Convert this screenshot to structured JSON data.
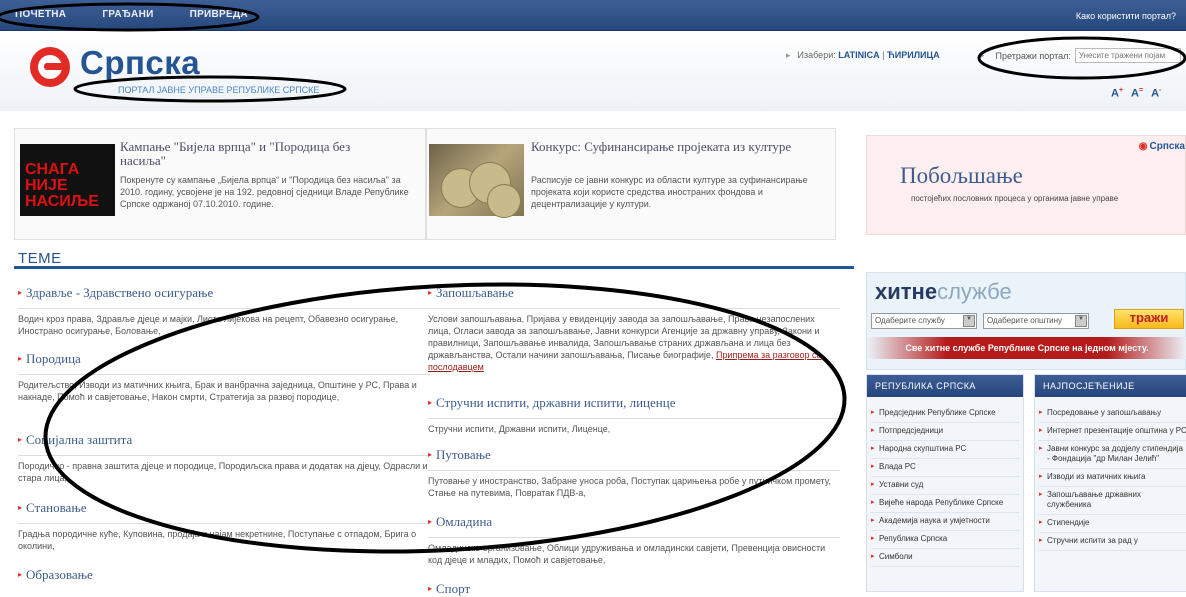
{
  "top_nav": [
    "ПОЧЕТНА",
    "ГРАЂАНИ",
    "ПРИВРЕДА"
  ],
  "help_link": "Како користити портал?",
  "logo": {
    "text": "Српска",
    "subtitle": "ПОРТАЛ ЈАВНЕ УПРАВЕ РЕПУБЛИКЕ СРПСКЕ"
  },
  "language": {
    "label": "Изабери:",
    "latin": "LATINICA",
    "cyrillic": "ЋИРИЛИЦА"
  },
  "search": {
    "label": "Претражи портал:",
    "placeholder": "Унесите тражени појам"
  },
  "font_controls": [
    "A",
    "A",
    "A"
  ],
  "font_marks": [
    "+",
    "=",
    "-"
  ],
  "news": [
    {
      "title": "Кампање \"Бијела врпца\" и \"Породица без насиља\"",
      "text": "Покренуте су кампање „Бијела врпца“ и \"Породица без насиља\" за 2010. годину, усвојене је на 192. редовној сједници Владе Републике Српске одржаној 07.10.2010. године.",
      "image_text": [
        "СНАГА НИЈЕ",
        "НАСИЉЕ"
      ]
    },
    {
      "title": "Конкурс: Суфинансирање пројеката из културе",
      "text": "Расписује се јавни конкурс из области културе за суфинансирање пројеката који користе средства иностраних фондова и децентрализације у култури."
    }
  ],
  "promo": {
    "logo": "Српска",
    "title": "Побољшање",
    "subtitle": "постојећих пословних процеса у органима јавне управе"
  },
  "section_title": "ТЕМЕ",
  "topics_left": [
    {
      "title": "Здравље - Здравствено осигурање",
      "text": "Водич кроз права, Здравље дјеце и мајки, Листа лијекова на рецепт, Обавезно осигурање, Инострано осигурање, Боловање,"
    },
    {
      "title": "Породица",
      "text": "Родитељство, Изводи из матичних књига, Брак и ванбрачна заједница, Општине у РС, Права и накнаде, Помоћ и савјетовање, Након смрти, Стратегија за развој породице,"
    },
    {
      "title": "Социјална заштита",
      "text": "Породично - правна заштита дјеце и породице, Породиљска права и додатак на дјецу, Одрасли и стара лица,"
    },
    {
      "title": "Становање",
      "text": "Градња породичне куће, Куповина, продаја и најам некретнине, Поступање с отпадом, Брига о околини,"
    },
    {
      "title": "Образовање",
      "text": ""
    }
  ],
  "topics_right": [
    {
      "title": "Запошљавање",
      "text": "Услови запошљавања, Пријава у евиденцију завода за запошљавање, Права незапослених лица, Огласи завода за запошљавање, Јавни конкурси Агенције за државну управу, Закони и правилници, Запошљавање инвалида, Запошљавање страних држављана и лица без држављанства, Остали начини запошљавања, Писање биографије, ",
      "link": "Припрема за разговор са послодавцем"
    },
    {
      "title": "Стручни испити, државни испити, лиценце",
      "text": "Стручни испити, Државни испити, Лиценце,"
    },
    {
      "title": "Путовање",
      "text": "Путовање у иностранство, Забране уноса роба, Поступак царињења робе у путничком промету, Стање на путевима, Повратак ПДВ-а,"
    },
    {
      "title": "Омладина",
      "text": "Омладинско организовање, Облици удруживања и омладински савјети, Превенција овисности код дјеце и младих, Помоћ и савјетовање,"
    },
    {
      "title": "Спорт",
      "text": ""
    }
  ],
  "hitne": {
    "title_bold": "хитне",
    "title_light": "службе",
    "select1": "Одаберите службу",
    "select2": "Одаберите општину",
    "button": "тражи",
    "note": "Све хитне службе Републике Српске на једном мјесту."
  },
  "col1": {
    "title": "РЕПУБЛИКА СРПСКА",
    "items": [
      "Предсједник Републике Српске",
      "Потпредсједници",
      "Народна скупштина РС",
      "Влада РС",
      "Уставни суд",
      "Вијеће народа Републике Српске",
      "Академија наука и умјетности",
      "Република Српска",
      "Симболи"
    ]
  },
  "col2": {
    "title": "НАЈПОСЈЕЋЕНИЈЕ",
    "items": [
      "Посредовање у запошљавању",
      "Интернет презентације општина у РС",
      "Јавни конкурс за додјелу стипендија - Фондација \"др Милан Јелић\"",
      "Изводи из матичних књига",
      "Запошљавање државних службеника",
      "Стипендије",
      "Стручни испити за рад у"
    ]
  }
}
